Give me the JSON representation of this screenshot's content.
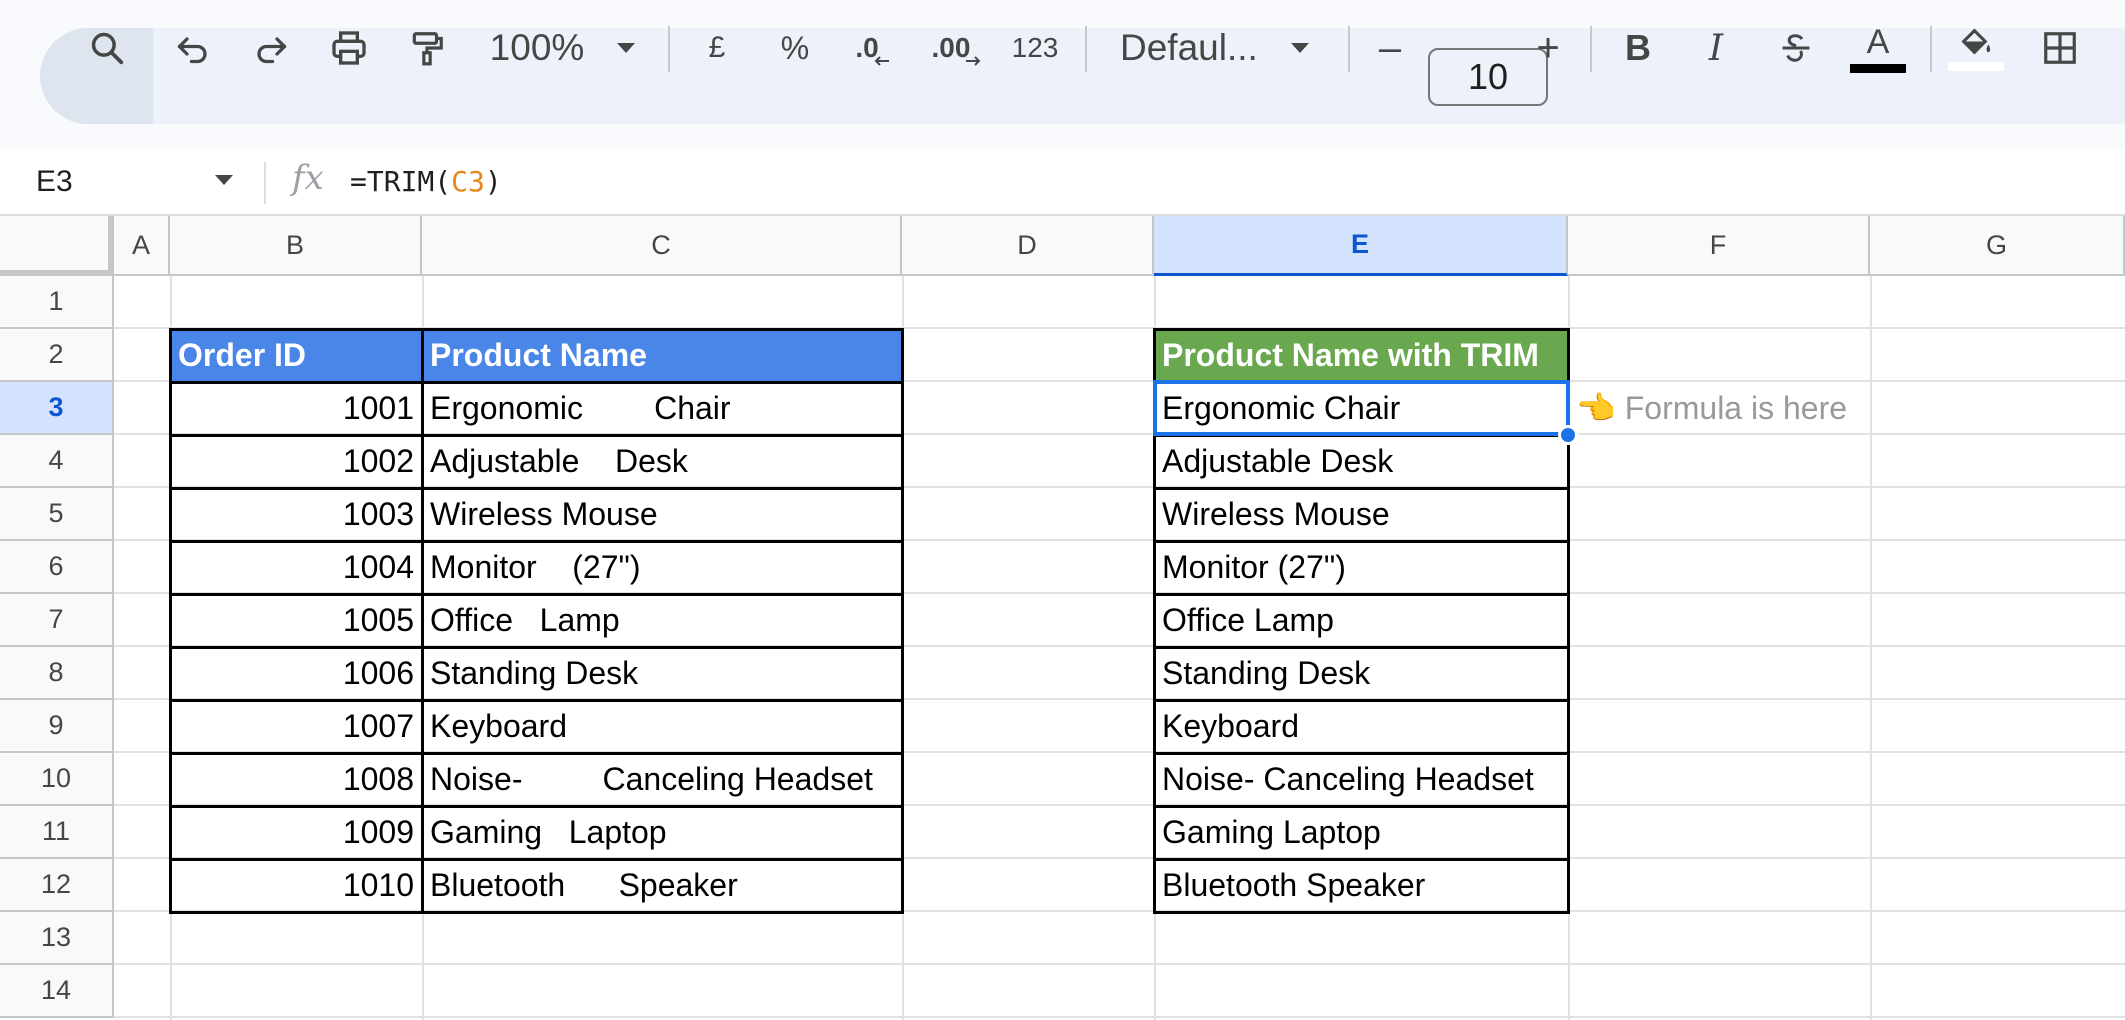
{
  "toolbar": {
    "zoom": "100%",
    "currency": "£",
    "percent": "%",
    "decrease_decimal": ".0",
    "increase_decimal": ".00",
    "number_format": "123",
    "font": "Defaul...",
    "font_size": "10",
    "minus": "–",
    "plus": "+",
    "bold": "B",
    "italic": "I",
    "text_color_letter": "A",
    "text_color": "#000000"
  },
  "formula_bar": {
    "name_box": "E3",
    "fx": "fx",
    "formula_prefix": "=TRIM(",
    "formula_ref": "C3",
    "formula_suffix": ")"
  },
  "columns": [
    "A",
    "B",
    "C",
    "D",
    "E",
    "F",
    "G"
  ],
  "rows": [
    "1",
    "2",
    "3",
    "4",
    "5",
    "6",
    "7",
    "8",
    "9",
    "10",
    "11",
    "12",
    "13",
    "14"
  ],
  "selected_cell": "E3",
  "table1": {
    "header_order_id": "Order ID",
    "header_product": "Product Name",
    "header_color": "#4a86e8",
    "order_ids": [
      "1001",
      "1002",
      "1003",
      "1004",
      "1005",
      "1006",
      "1007",
      "1008",
      "1009",
      "1010"
    ],
    "products": [
      "Ergonomic        Chair",
      "Adjustable    Desk",
      "Wireless Mouse",
      "Monitor    (27\")",
      "Office   Lamp",
      "Standing Desk",
      "Keyboard",
      "Noise-         Canceling Headset",
      "Gaming   Laptop",
      "Bluetooth      Speaker"
    ]
  },
  "table2": {
    "header": "Product Name with TRIM",
    "header_color": "#6aa84f",
    "values": [
      "Ergonomic Chair",
      "Adjustable Desk",
      "Wireless Mouse",
      "Monitor (27\")",
      "Office Lamp",
      "Standing Desk",
      "Keyboard",
      "Noise- Canceling Headset",
      "Gaming Laptop",
      "Bluetooth Speaker"
    ]
  },
  "note": {
    "icon": "👈",
    "text": "Formula is here"
  }
}
